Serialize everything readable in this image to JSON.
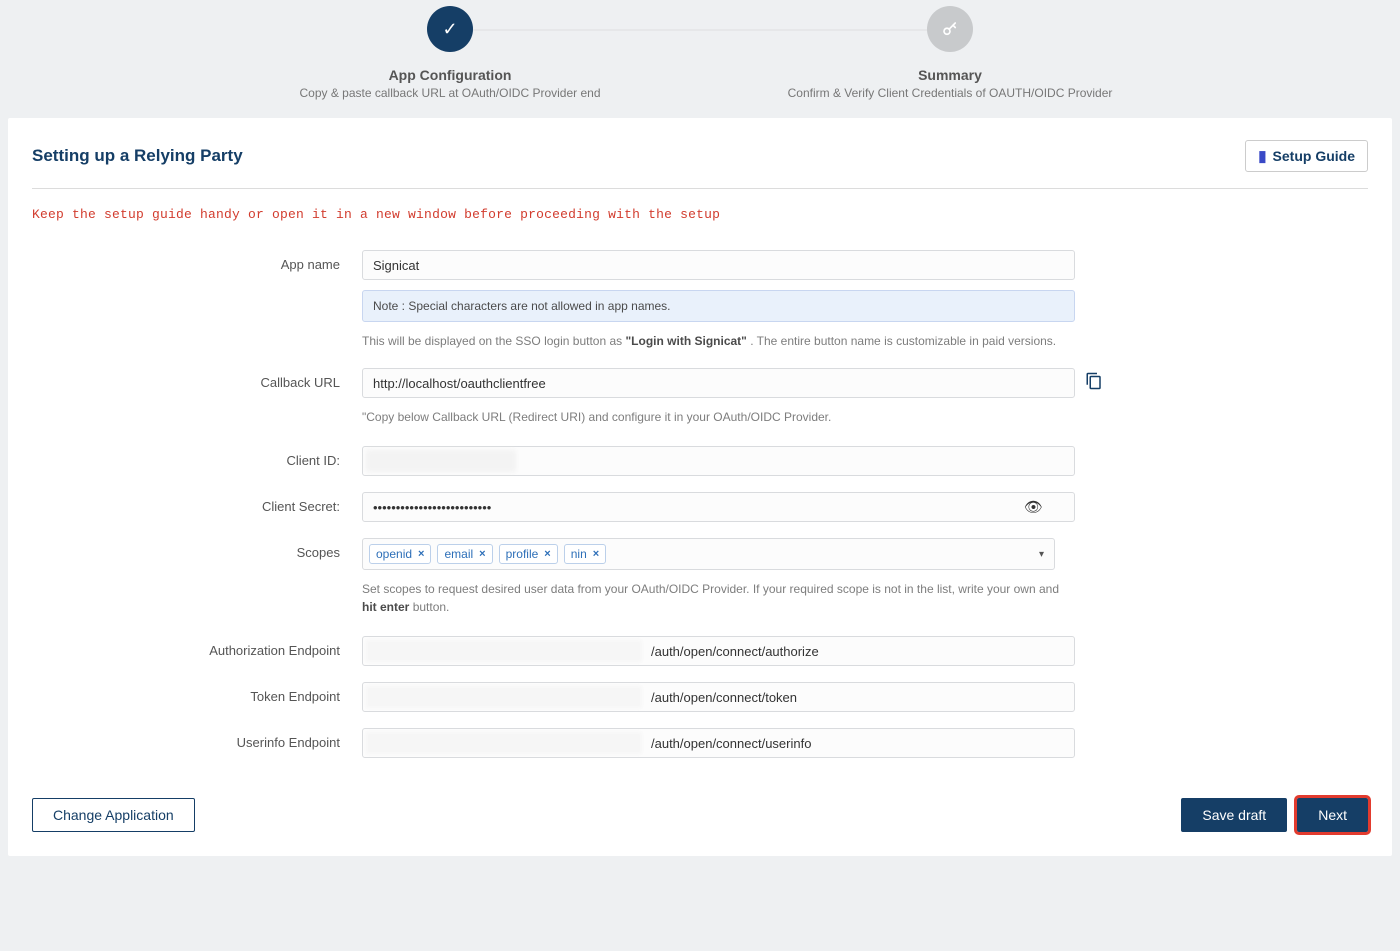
{
  "stepper": {
    "steps": [
      {
        "title": "App Configuration",
        "sub": "Copy & paste callback URL at OAuth/OIDC Provider end",
        "state": "active",
        "icon": "check"
      },
      {
        "title": "Summary",
        "sub": "Confirm & Verify Client Credentials of OAUTH/OIDC Provider",
        "state": "pending",
        "icon": "key"
      }
    ]
  },
  "header": {
    "title": "Setting up a Relying Party",
    "setup_guide_label": "Setup Guide"
  },
  "warning": "Keep the setup guide handy or open it in a new window before proceeding with the setup",
  "form": {
    "app_name": {
      "label": "App name",
      "value": "Signicat",
      "note": "Note : Special characters are not allowed in app names.",
      "help_prefix": "This will be displayed on the SSO login button as ",
      "help_bold": "\"Login with Signicat\"",
      "help_suffix": ". The entire button name is customizable in paid versions."
    },
    "callback_url": {
      "label": "Callback URL",
      "value": "http://localhost/oauthclientfree",
      "help": "\"Copy below Callback URL (Redirect URI) and configure it in your OAuth/OIDC Provider."
    },
    "client_id": {
      "label": "Client ID:",
      "value": ""
    },
    "client_secret": {
      "label": "Client Secret:",
      "value": "••••••••••••••••••••••••••"
    },
    "scopes": {
      "label": "Scopes",
      "items": [
        "openid",
        "email",
        "profile",
        "nin"
      ],
      "help_prefix": "Set scopes to request desired user data from your OAuth/OIDC Provider. If your required scope is not in the list, write your own and ",
      "help_bold": "hit enter",
      "help_suffix": " button."
    },
    "auth_endpoint": {
      "label": "Authorization Endpoint",
      "value": "/auth/open/connect/authorize"
    },
    "token_endpoint": {
      "label": "Token Endpoint",
      "value": "/auth/open/connect/token"
    },
    "userinfo_endpoint": {
      "label": "Userinfo Endpoint",
      "value": "/auth/open/connect/userinfo"
    }
  },
  "footer": {
    "change_app": "Change Application",
    "save_draft": "Save draft",
    "next": "Next"
  }
}
